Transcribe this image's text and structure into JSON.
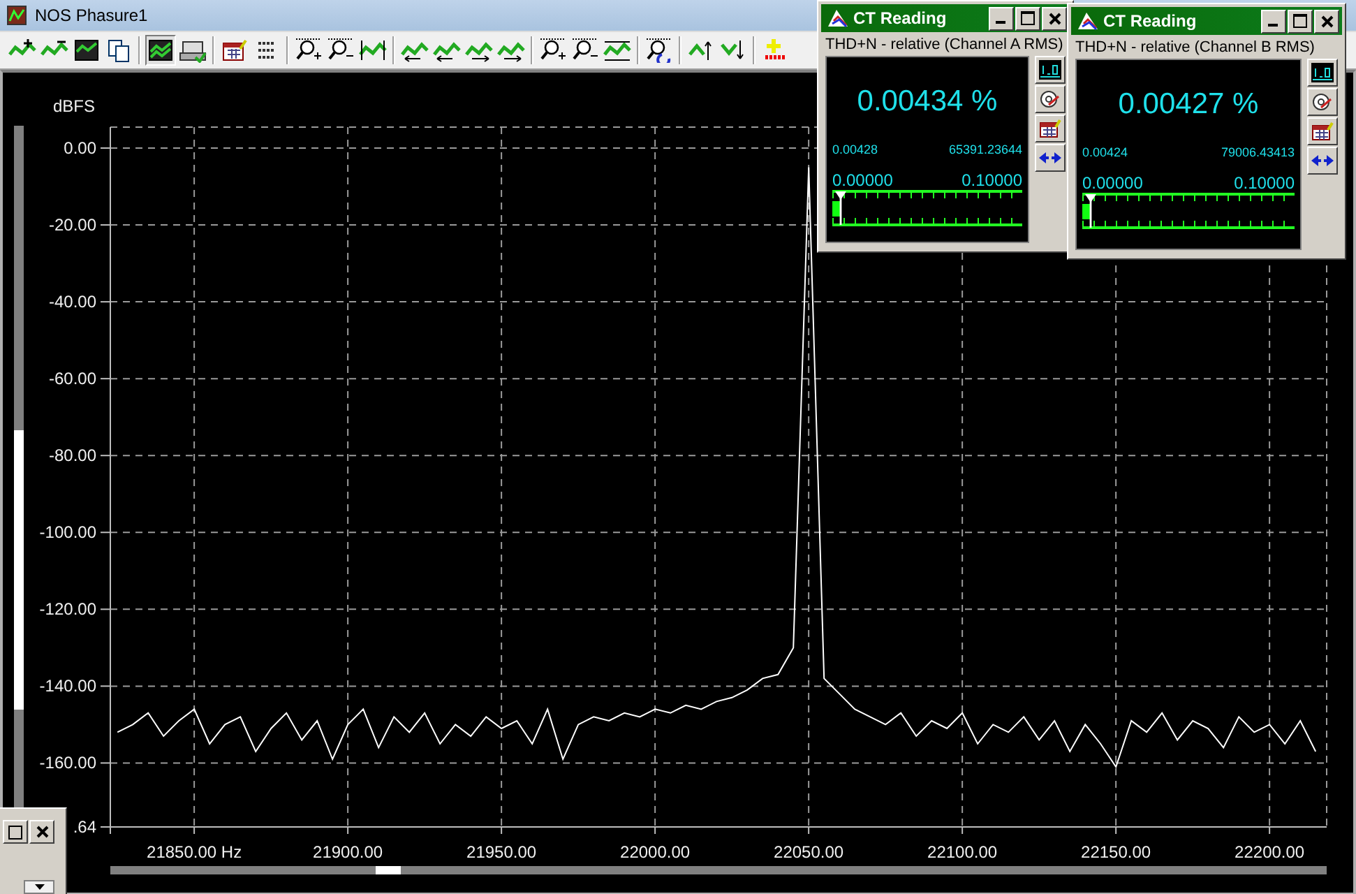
{
  "window": {
    "title": "NOS Phasure1"
  },
  "toolbar": {
    "groups": [
      [
        {
          "kind": "wave-plus",
          "pressed": false
        },
        {
          "kind": "wave-minus",
          "pressed": false
        },
        {
          "kind": "chart-image",
          "pressed": false
        },
        {
          "kind": "copy",
          "pressed": false
        }
      ],
      [
        {
          "kind": "wave-double",
          "pressed": true
        },
        {
          "kind": "printer",
          "pressed": false
        }
      ],
      [
        {
          "kind": "calendar",
          "pressed": false
        },
        {
          "kind": "number-list",
          "pressed": false
        }
      ],
      [
        {
          "kind": "zoom-in",
          "pressed": false
        },
        {
          "kind": "zoom-out",
          "pressed": false
        },
        {
          "kind": "wave-full",
          "pressed": false
        }
      ],
      [
        {
          "kind": "wave-left",
          "pressed": false
        },
        {
          "kind": "wave-left-small",
          "pressed": false
        },
        {
          "kind": "wave-right-small",
          "pressed": false
        },
        {
          "kind": "wave-right",
          "pressed": false
        }
      ],
      [
        {
          "kind": "zoom-in",
          "pressed": false
        },
        {
          "kind": "zoom-out",
          "pressed": false
        },
        {
          "kind": "wave-box",
          "pressed": false
        }
      ],
      [
        {
          "kind": "zoom-refresh",
          "pressed": false
        }
      ],
      [
        {
          "kind": "wave-up",
          "pressed": false
        },
        {
          "kind": "wave-down",
          "pressed": false
        }
      ],
      [
        {
          "kind": "cross",
          "pressed": false
        }
      ]
    ]
  },
  "graph": {
    "y_axis_bottom_label": ".64",
    "chart_data": {
      "type": "line",
      "grid": true,
      "ylabel": "dBFS",
      "xlim": [
        21822.7,
        22218.6
      ],
      "ylim": [
        -176.64,
        5.45
      ],
      "xticks": [
        {
          "value": 21850,
          "label": "21850.00 Hz"
        },
        {
          "value": 21900,
          "label": "21900.00"
        },
        {
          "value": 21950,
          "label": "21950.00"
        },
        {
          "value": 22000,
          "label": "22000.00"
        },
        {
          "value": 22050,
          "label": "22050.00"
        },
        {
          "value": 22100,
          "label": "22100.00"
        },
        {
          "value": 22150,
          "label": "22150.00"
        },
        {
          "value": 22200,
          "label": "22200.00"
        }
      ],
      "yticks": [
        {
          "value": 0,
          "label": "0.00"
        },
        {
          "value": -20,
          "label": "-20.00"
        },
        {
          "value": -40,
          "label": "-40.00"
        },
        {
          "value": -60,
          "label": "-60.00"
        },
        {
          "value": -80,
          "label": "-80.00"
        },
        {
          "value": -100,
          "label": "-100.00"
        },
        {
          "value": -120,
          "label": "-120.00"
        },
        {
          "value": -140,
          "label": "-140.00"
        },
        {
          "value": -160,
          "label": "-160.00"
        }
      ],
      "x": [
        21825,
        21830,
        21835,
        21840,
        21845,
        21850,
        21855,
        21860,
        21865,
        21870,
        21875,
        21880,
        21885,
        21890,
        21895,
        21900,
        21905,
        21910,
        21915,
        21920,
        21925,
        21930,
        21935,
        21940,
        21945,
        21950,
        21955,
        21960,
        21965,
        21970,
        21975,
        21980,
        21985,
        21990,
        21995,
        22000,
        22005,
        22010,
        22015,
        22020,
        22025,
        22030,
        22035,
        22040,
        22045,
        22050,
        22055,
        22060,
        22065,
        22070,
        22075,
        22080,
        22085,
        22090,
        22095,
        22100,
        22105,
        22110,
        22115,
        22120,
        22125,
        22130,
        22135,
        22140,
        22145,
        22150,
        22155,
        22160,
        22165,
        22170,
        22175,
        22180,
        22185,
        22190,
        22195,
        22200,
        22205,
        22210,
        22215
      ],
      "series": [
        {
          "color": "#ffffff",
          "values": [
            -152,
            -150,
            -147,
            -153,
            -149,
            -146,
            -155,
            -150,
            -148,
            -157,
            -151,
            -147,
            -154,
            -149,
            -159,
            -150,
            -146,
            -156,
            -148,
            -152,
            -147,
            -155,
            -150,
            -153,
            -148,
            -151,
            -149,
            -155,
            -146,
            -159,
            -150,
            -148,
            -149,
            -147,
            -148,
            -146,
            -147,
            -145,
            -146,
            -144,
            -143,
            -141,
            -138,
            -137,
            -130,
            -5,
            -138,
            -142,
            -146,
            -148,
            -150,
            -147,
            -153,
            -149,
            -151,
            -147,
            -155,
            -150,
            -152,
            -148,
            -154,
            -149,
            -157,
            -150,
            -155,
            -161,
            -149,
            -152,
            -147,
            -154,
            -149,
            -151,
            -156,
            -148,
            -152,
            -150,
            -155,
            -149,
            -157
          ]
        }
      ]
    }
  },
  "readings": [
    {
      "title": "CT Reading",
      "measurement": "THD+N - relative (Channel A RMS)",
      "value": "0.00434 %",
      "reading_1": "0.00428",
      "reading_2": "65391.23644",
      "scale_min": "0.00000",
      "scale_max": "0.10000",
      "level": 0.0434
    },
    {
      "title": "CT Reading",
      "measurement": "THD+N - relative (Channel B RMS)",
      "value": "0.00427 %",
      "reading_1": "0.00424",
      "reading_2": "79006.43413",
      "scale_min": "0.00000",
      "scale_max": "0.10000",
      "level": 0.0427
    }
  ]
}
